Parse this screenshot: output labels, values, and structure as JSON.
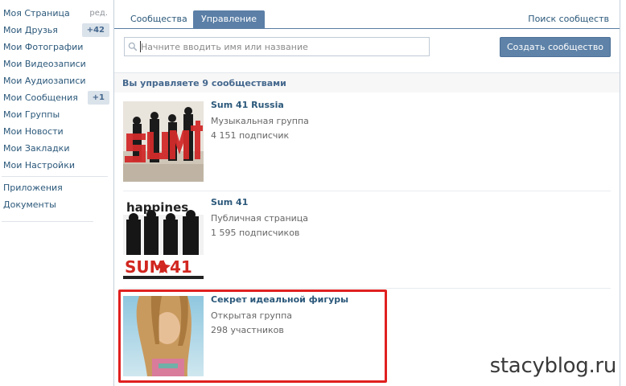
{
  "sidebar": {
    "items": [
      {
        "label": "Моя Страница",
        "aux": "ред."
      },
      {
        "label": "Мои Друзья",
        "badge": "+42"
      },
      {
        "label": "Мои Фотографии"
      },
      {
        "label": "Мои Видеозаписи"
      },
      {
        "label": "Мои Аудиозаписи"
      },
      {
        "label": "Мои Сообщения",
        "badge": "+1"
      },
      {
        "label": "Мои Группы"
      },
      {
        "label": "Мои Новости"
      },
      {
        "label": "Мои Закладки"
      },
      {
        "label": "Мои Настройки"
      }
    ],
    "extra_items": [
      {
        "label": "Приложения"
      },
      {
        "label": "Документы"
      }
    ]
  },
  "tabs": [
    {
      "label": "Сообщества",
      "active": false
    },
    {
      "label": "Управление",
      "active": true
    }
  ],
  "search_link": "Поиск сообществ",
  "search": {
    "placeholder": "Начните вводить имя или название",
    "value": "",
    "icon": "magnifier-icon"
  },
  "create_button": "Создать сообщество",
  "section_title": "Вы управляете 9 сообществами",
  "groups": [
    {
      "name": "Sum 41 Russia",
      "type": "Музыкальная группа",
      "members": "4 151 подписчик"
    },
    {
      "name": "Sum 41",
      "type": "Публичная страница",
      "members": "1 595 подписчиков"
    },
    {
      "name": "Секрет идеальной фигуры",
      "type": "Открытая группа",
      "members": "298 участников"
    }
  ],
  "watermark": "stacyblog.ru",
  "colors": {
    "link": "#2b587a",
    "accent": "#5b7fa6",
    "highlight": "#e02020",
    "badge_bg": "#dae2ea"
  }
}
